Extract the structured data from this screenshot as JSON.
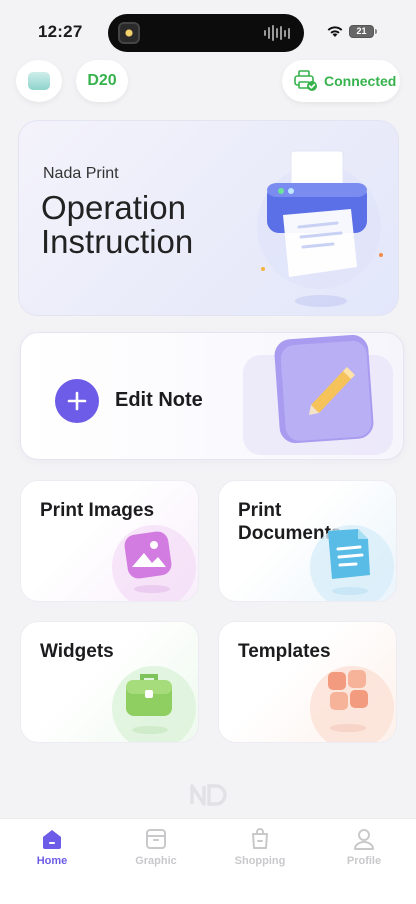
{
  "status_bar": {
    "time": "12:27",
    "battery": "21"
  },
  "header": {
    "device_model": "D20",
    "connection_status": "Connected"
  },
  "hero": {
    "brand": "Nada Print",
    "title": "Operation Instruction"
  },
  "edit_note": {
    "label": "Edit Note"
  },
  "tiles": [
    {
      "label": "Print Images"
    },
    {
      "label": "Print Documents"
    },
    {
      "label": "Widgets"
    },
    {
      "label": "Templates"
    }
  ],
  "tabbar": {
    "active_index": 0,
    "tabs": [
      {
        "label": "Home",
        "icon": "home-icon"
      },
      {
        "label": "Graphic",
        "icon": "graphic-icon"
      },
      {
        "label": "Shopping",
        "icon": "shopping-bag-icon"
      },
      {
        "label": "Profile",
        "icon": "profile-icon"
      }
    ]
  },
  "colors": {
    "accent": "#6c5ce7",
    "connected_green": "#37b24d",
    "inactive_tab": "#c9c9cc"
  }
}
